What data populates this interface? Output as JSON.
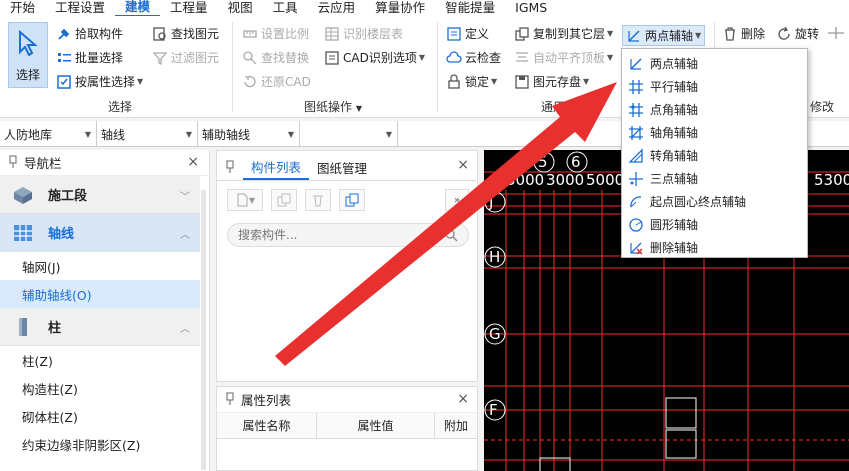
{
  "menubar": {
    "items": [
      "开始",
      "工程设置",
      "建模",
      "工程量",
      "视图",
      "工具",
      "云应用",
      "算量协作",
      "智能提量",
      "IGMS"
    ],
    "active_index": 2
  },
  "ribbon": {
    "select": {
      "label": "选择"
    },
    "select_group": {
      "pick": "拾取构件",
      "batch": "批量选择",
      "by_attr": "按属性选择",
      "find_elem": "查找图元",
      "filter_elem": "过滤图元",
      "group_label": "选择"
    },
    "drawing_group": {
      "set_scale": "设置比例",
      "recognize_floors": "识别楼层表",
      "find_replace": "查找替换",
      "cad_options": "CAD识别选项",
      "restore_cad": "还原CAD",
      "group_label": "图纸操作"
    },
    "general_group": {
      "define": "定义",
      "copy_to_floor": "复制到其它层",
      "two_point_axis": "两点辅轴",
      "cloud_check": "云检查",
      "auto_align": "自动平齐顶板",
      "lock": "锁定",
      "elem_save": "图元存盘",
      "group_label": "通用操"
    },
    "modify_group": {
      "delete": "删除",
      "rotate": "旋转",
      "group_label": "修改"
    }
  },
  "filterbar": {
    "category": "人防地库",
    "type": "轴线",
    "subtype": "辅助轴线",
    "blank": ""
  },
  "nav": {
    "title": "导航栏",
    "groups": [
      {
        "label": "施工段",
        "items": []
      },
      {
        "label": "轴线",
        "items": [
          "轴网(J)",
          "辅助轴线(O)"
        ]
      },
      {
        "label": "柱",
        "items": [
          "柱(Z)",
          "构造柱(Z)",
          "砌体柱(Z)",
          "约束边缘非阴影区(Z)"
        ]
      }
    ]
  },
  "components": {
    "tabs": [
      "构件列表",
      "图纸管理"
    ],
    "search_placeholder": "搜索构件..."
  },
  "properties": {
    "title": "属性列表",
    "columns": [
      "属性名称",
      "属性值",
      "附加"
    ]
  },
  "cad": {
    "top_labels": [
      "5",
      "6",
      "3000",
      "3000",
      "5000",
      "5300"
    ],
    "axis_labels": [
      "J",
      "H",
      "G",
      "F"
    ]
  },
  "dropdown": {
    "items": [
      "两点辅轴",
      "平行辅轴",
      "点角辅轴",
      "轴角辅轴",
      "转角辅轴",
      "三点辅轴",
      "起点圆心终点辅轴",
      "圆形辅轴",
      "删除辅轴"
    ]
  },
  "colors": {
    "accent": "#1a6fd6",
    "cad_line": "#ff2a2a",
    "arrow": "#e8302f"
  }
}
